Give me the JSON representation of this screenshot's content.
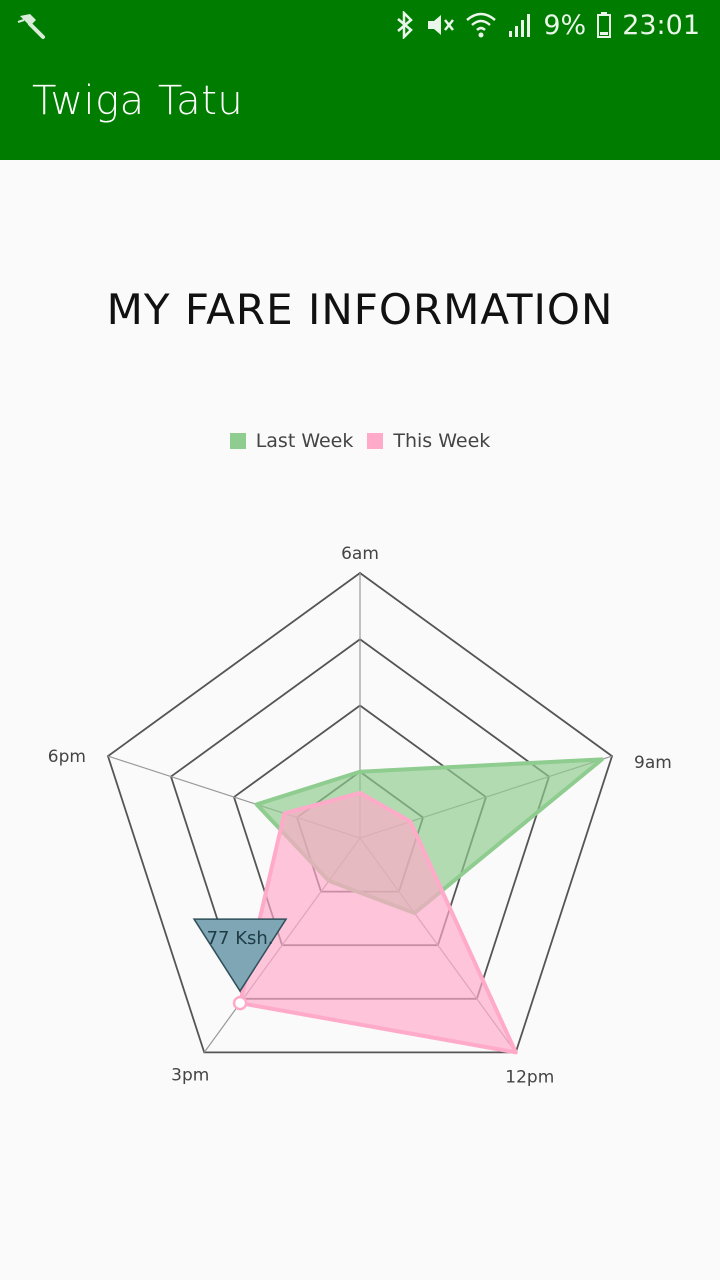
{
  "status_bar": {
    "battery": "9%",
    "time": "23:01",
    "icons": [
      "app-notification-icon",
      "bluetooth-icon",
      "mute-icon",
      "wifi-icon",
      "signal-icon",
      "battery-icon"
    ]
  },
  "app_bar": {
    "title": "Twiga Tatu",
    "color": "#007d00"
  },
  "page": {
    "title": "MY FARE INFORMATION"
  },
  "chart_data": {
    "type": "radar",
    "categories": [
      "6am",
      "9am",
      "12pm",
      "3pm",
      "6pm"
    ],
    "rmax": 100,
    "rings": 4,
    "series": [
      {
        "name": "Last Week",
        "values": [
          25,
          96,
          35,
          20,
          41
        ],
        "color": "#8fcc8f"
      },
      {
        "name": "This Week",
        "values": [
          17,
          20,
          100,
          77,
          30
        ],
        "color": "#ffaac8"
      }
    ],
    "legend_position": "top",
    "tooltip": {
      "label": "77 Ksh.",
      "category": "3pm",
      "series": "This Week"
    }
  }
}
